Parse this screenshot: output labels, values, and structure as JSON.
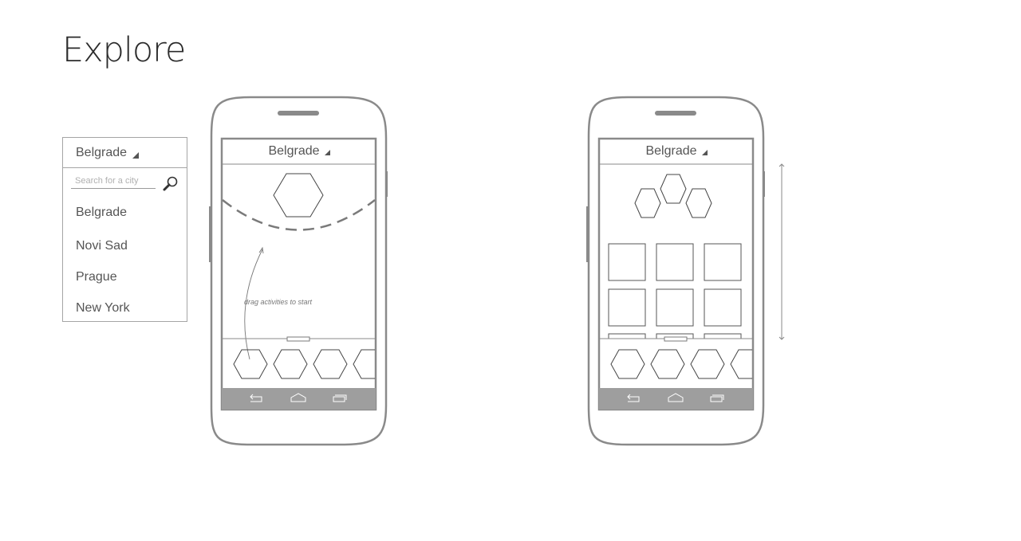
{
  "page": {
    "title": "Explore"
  },
  "dropdown": {
    "selected": "Belgrade",
    "search_placeholder": "Search for a city",
    "options": [
      "Belgrade",
      "Novi Sad",
      "Prague",
      "New York"
    ]
  },
  "phone_left": {
    "city": "Belgrade",
    "hint": "drag activities to start"
  },
  "phone_right": {
    "city": "Belgrade"
  },
  "colors": {
    "stroke": "#8a8a8a",
    "navbar": "#9e9e9e",
    "text": "#555555"
  },
  "icons": [
    "search-icon",
    "dropdown-arrow-icon",
    "back-icon",
    "home-icon",
    "recent-apps-icon",
    "hexagon-icon"
  ]
}
